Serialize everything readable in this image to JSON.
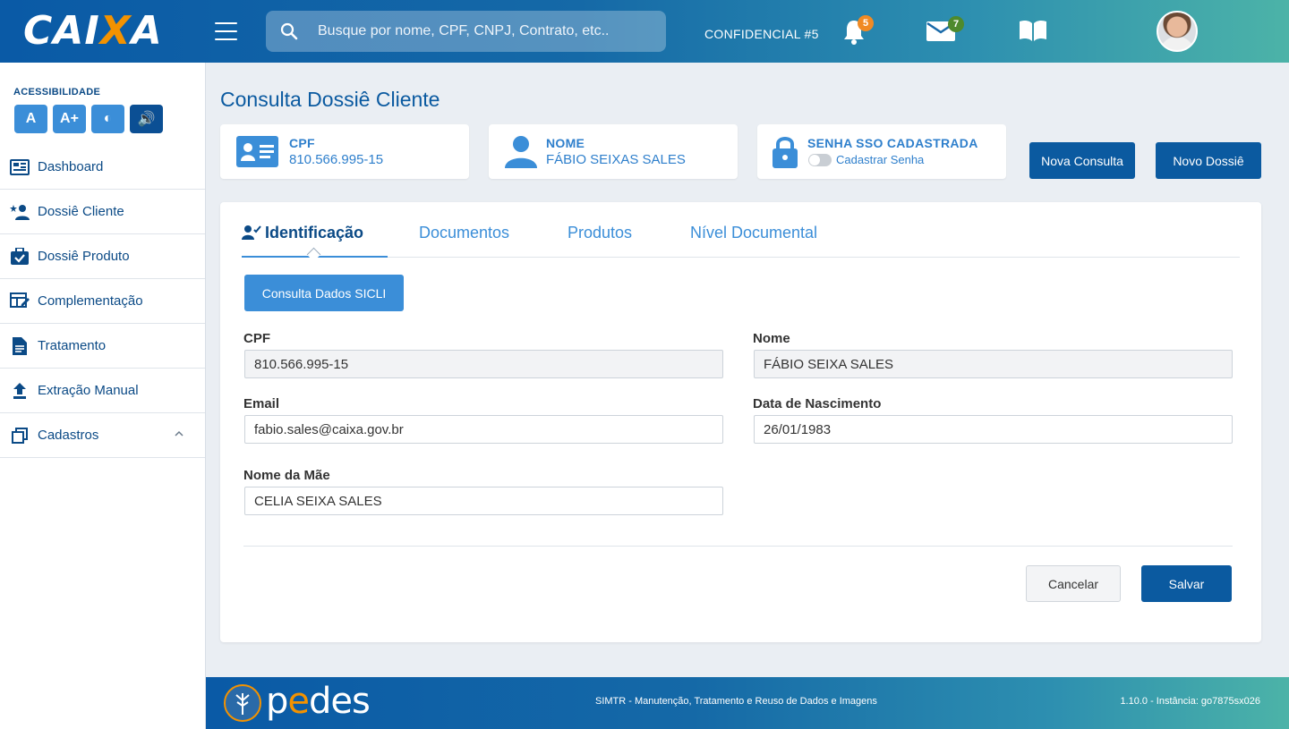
{
  "header": {
    "logo": "CAIXA",
    "search_placeholder": "Busque por nome, CPF, CNPJ, Contrato, etc..",
    "confidential": "CONFIDENCIAL #5",
    "notifications_count": "5",
    "messages_count": "7",
    "brand_color": "#0a5aa6",
    "accent_color": "#f39200"
  },
  "sidebar": {
    "accessibility_title": "ACESSIBILIDADE",
    "acc_buttons": [
      "A",
      "A+",
      "◐",
      "🔊"
    ],
    "items": [
      {
        "label": "Dashboard",
        "icon": "dashboard-icon"
      },
      {
        "label": "Dossiê Cliente",
        "icon": "user-star-icon"
      },
      {
        "label": "Dossiê Produto",
        "icon": "briefcase-check-icon"
      },
      {
        "label": "Complementação",
        "icon": "table-edit-icon"
      },
      {
        "label": "Tratamento",
        "icon": "document-icon"
      },
      {
        "label": "Extração Manual",
        "icon": "upload-icon"
      },
      {
        "label": "Cadastros",
        "icon": "copy-icon"
      }
    ]
  },
  "main": {
    "title": "Consulta Dossiê Cliente",
    "cpf_card": {
      "label": "CPF",
      "value": "810.566.995-15"
    },
    "nome_card": {
      "label": "NOME",
      "value": "FÁBIO SEIXAS SALES"
    },
    "senha_card": {
      "label": "SENHA SSO CADASTRADA",
      "toggle_label": "Cadastrar Senha"
    },
    "nova_consulta": "Nova Consulta",
    "novo_dossie": "Novo Dossiê",
    "tabs": [
      "Identificação",
      "Documentos",
      "Produtos",
      "Nível Documental"
    ],
    "sicli_button": "Consulta Dados SICLI",
    "form": {
      "cpf_label": "CPF",
      "cpf_value": "810.566.995-15",
      "nome_label": "Nome",
      "nome_value": "FÁBIO SEIXA SALES",
      "email_label": "Email",
      "email_value": "fabio.sales@caixa.gov.br",
      "nasc_label": "Data de Nascimento",
      "nasc_value": "26/01/1983",
      "mae_label": "Nome da Mãe",
      "mae_value": "CELIA SEIXA SALES"
    },
    "cancel": "Cancelar",
    "save": "Salvar"
  },
  "footer": {
    "brand_prefix": "p",
    "brand_e": "e",
    "brand_suffix": "des",
    "system": "SIMTR - Manutenção, Tratamento e Reuso de Dados e Imagens",
    "version": "1.10.0 - Instância: go7875sx026"
  }
}
